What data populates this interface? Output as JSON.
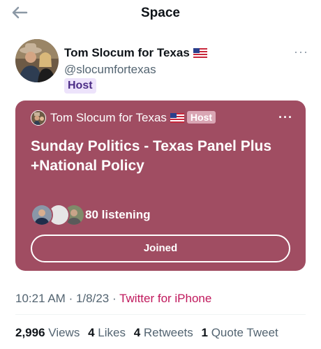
{
  "header": {
    "title": "Space",
    "back_icon": "arrow-left-icon"
  },
  "author": {
    "name": "Tom Slocum for Texas",
    "flag": "🇺🇸",
    "handle": "@slocumfortexas",
    "role_badge": "Host",
    "more_label": "···"
  },
  "space_card": {
    "host_name": "Tom Slocum for Texas",
    "flag": "🇺🇸",
    "host_badge": "Host",
    "more_label": "···",
    "title": "Sunday Politics -  Texas Panel Plus +National Policy",
    "listening": "80 listening",
    "join_button": "Joined",
    "background_color": "#a04d62"
  },
  "meta": {
    "time": "10:21 AM",
    "date": "1/8/23",
    "separator": "·",
    "source": "Twitter for iPhone"
  },
  "stats": [
    {
      "count": "2,996",
      "label": "Views"
    },
    {
      "count": "4",
      "label": "Likes"
    },
    {
      "count": "4",
      "label": "Retweets"
    },
    {
      "count": "1",
      "label": "Quote Tweet"
    }
  ]
}
